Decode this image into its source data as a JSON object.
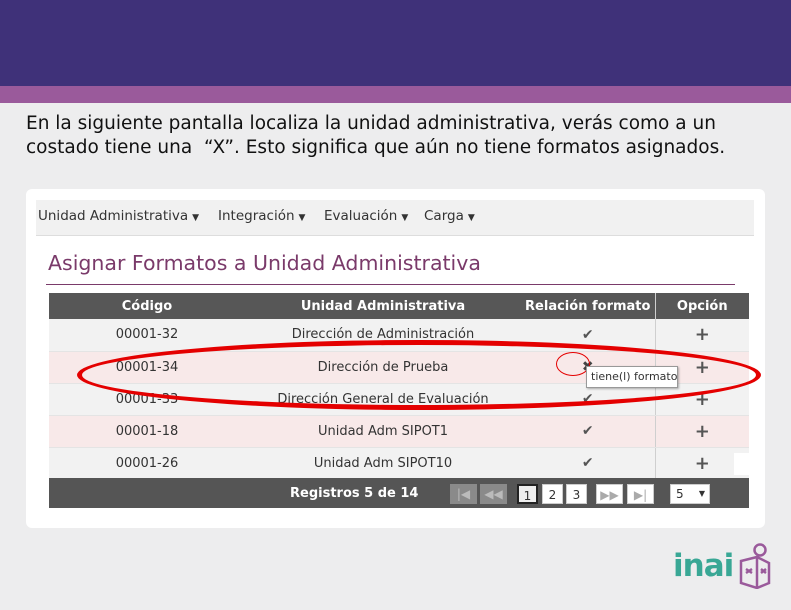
{
  "caption": {
    "line1": "En la siguiente pantalla localiza la unidad administrativa, verás como a un",
    "line2": "costado tiene una  “X”. Esto significa que aún no tiene formatos asignados."
  },
  "nav": {
    "items": [
      {
        "label": "Unidad Administrativa"
      },
      {
        "label": "Integración"
      },
      {
        "label": "Evaluación"
      },
      {
        "label": "Carga"
      }
    ]
  },
  "page": {
    "title": "Asignar Formatos a Unidad Administrativa"
  },
  "table": {
    "headers": [
      "Código",
      "Unidad Administrativa",
      "Relación formato",
      "Opción"
    ],
    "rows": [
      {
        "codigo": "00001-32",
        "unidad": "Dirección de Administración",
        "relacion": "check"
      },
      {
        "codigo": "00001-34",
        "unidad": "Dirección de Prueba",
        "relacion": "x"
      },
      {
        "codigo": "00001-33",
        "unidad": "Dirección General de Evaluación",
        "relacion": "check"
      },
      {
        "codigo": "00001-18",
        "unidad": "Unidad Adm SIPOT1",
        "relacion": "check"
      },
      {
        "codigo": "00001-26",
        "unidad": "Unidad Adm SIPOT10",
        "relacion": "check"
      }
    ],
    "tooltip": "tiene(l) formato(s)"
  },
  "pagination": {
    "records": "Registros 5 de 14",
    "pages": [
      "1",
      "2",
      "3"
    ],
    "current_page": "1",
    "page_size": "5"
  },
  "logo": {
    "text": "inai"
  },
  "colors": {
    "banner": "#3f3179",
    "stripe": "#9a5a9b",
    "title": "#7a3a6a",
    "highlight": "#e40000",
    "logo": "#39a795"
  },
  "icons": {
    "caret": "caret-down-icon",
    "check": "check-icon",
    "x": "x-mark-icon",
    "plus": "plus-icon",
    "first": "first-page-icon",
    "prev": "previous-page-icon",
    "next": "next-page-icon",
    "last": "last-page-icon"
  }
}
